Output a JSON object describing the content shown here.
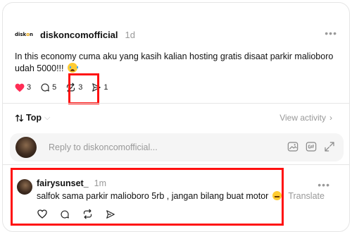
{
  "post": {
    "author": "diskoncomofficial",
    "avatar_text": "disk",
    "avatar_text_accent": "o",
    "avatar_text_end": "n",
    "time": "1d",
    "text": "In this economy cuma aku yang kasih kalian hosting gratis disaat parkir malioboro udah 5000!!!",
    "emoji": "crying-face",
    "likes": "3",
    "replies": "5",
    "reposts": "3",
    "shares": "1",
    "liked": true
  },
  "sort": {
    "label": "Top",
    "icon": "sort-arrows-icon",
    "view_activity": "View activity"
  },
  "reply_box": {
    "placeholder": "Reply to diskoncomofficial..."
  },
  "comment": {
    "author": "fairysunset_",
    "time": "1m",
    "text": "salfok sama parkir malioboro 5rb , jangan bilang buat motor",
    "emoji": "slightly-smiling-face",
    "translate": "Translate"
  },
  "colors": {
    "like": "#ff2d55",
    "highlight": "#ff1010",
    "muted": "#999999"
  }
}
